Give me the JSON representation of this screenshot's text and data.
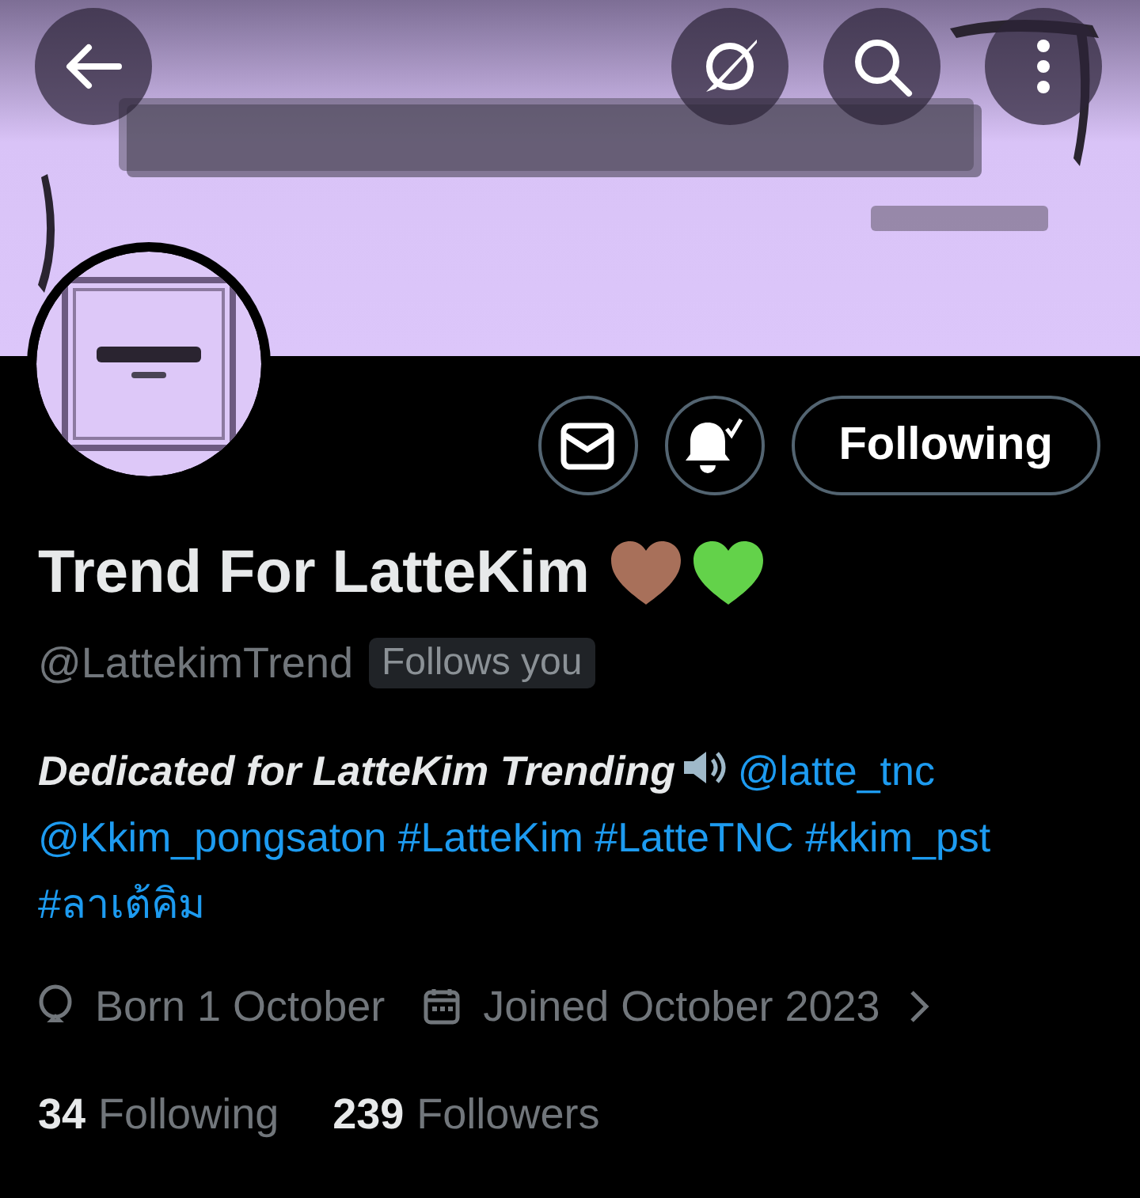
{
  "actions": {
    "follow_button": "Following",
    "notifications_on": true
  },
  "profile": {
    "name": "Trend For LatteKim",
    "handle": "@LattekimTrend",
    "follows_you_badge": "Follows you"
  },
  "bio": [
    {
      "kind": "lead",
      "text": "Dedicated for LatteKim Trending"
    },
    {
      "kind": "link",
      "text": "@latte_tnc"
    },
    {
      "kind": "link",
      "text": "@Kkim_pongsaton"
    },
    {
      "kind": "link",
      "text": "#LatteKim"
    },
    {
      "kind": "link",
      "text": "#LatteTNC"
    },
    {
      "kind": "link",
      "text": "#kkim_pst"
    },
    {
      "kind": "link",
      "text": "#ลาเต้คิม"
    }
  ],
  "details": [
    {
      "kind": "birthday",
      "text": "Born 1 October"
    },
    {
      "kind": "joined",
      "text": "Joined October 2023"
    }
  ],
  "stats": [
    {
      "count": "34",
      "label": "Following"
    },
    {
      "count": "239",
      "label": "Followers"
    }
  ]
}
